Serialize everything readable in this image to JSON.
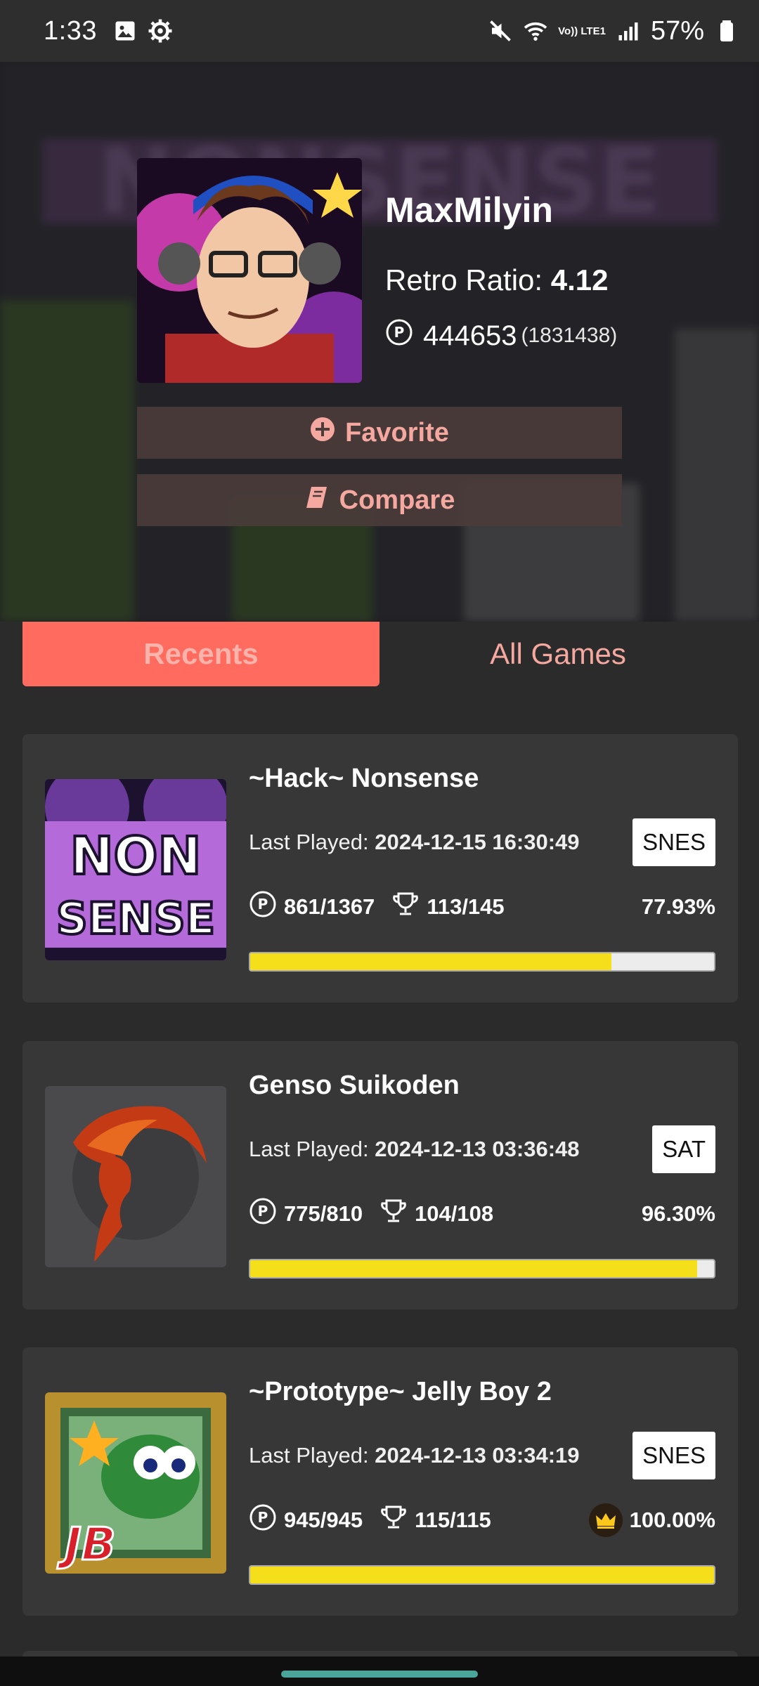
{
  "status_bar": {
    "time": "1:33",
    "battery": "57%",
    "network": "Vo)) LTE1"
  },
  "profile": {
    "username": "MaxMilyin",
    "retro_ratio_label": "Retro Ratio:",
    "retro_ratio_value": "4.12",
    "points": "444653",
    "points_total": "(1831438)",
    "favorite_label": "Favorite",
    "compare_label": "Compare"
  },
  "tabs": {
    "recents": "Recents",
    "all_games": "All Games",
    "active": "recents"
  },
  "games": [
    {
      "title": "~Hack~ Nonsense",
      "last_played_label": "Last Played:",
      "last_played": "2024-12-15 16:30:49",
      "console": "SNES",
      "points": "861/1367",
      "achievements": "113/145",
      "percent": "77.93%",
      "progress": 0.7793,
      "mastered": false
    },
    {
      "title": "Genso Suikoden",
      "last_played_label": "Last Played:",
      "last_played": "2024-12-13 03:36:48",
      "console": "SAT",
      "points": "775/810",
      "achievements": "104/108",
      "percent": "96.30%",
      "progress": 0.963,
      "mastered": false
    },
    {
      "title": "~Prototype~ Jelly Boy 2",
      "last_played_label": "Last Played:",
      "last_played": "2024-12-13 03:34:19",
      "console": "SNES",
      "points": "945/945",
      "achievements": "115/115",
      "percent": "100.00%",
      "progress": 1.0,
      "mastered": true
    }
  ],
  "colors": {
    "accent": "#ff6b5e",
    "accent_text": "#f5a8a0",
    "progress_fill": "#f5df1a",
    "card_bg": "#373737",
    "page_bg": "#2b2b2b"
  }
}
